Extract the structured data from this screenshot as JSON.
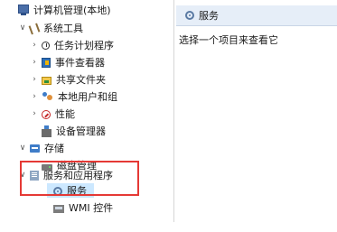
{
  "tree": {
    "root": "计算机管理(本地)",
    "system_tools": {
      "label": "系统工具",
      "items": [
        "任务计划程序",
        "事件查看器",
        "共享文件夹",
        "本地用户和组",
        "性能",
        "设备管理器"
      ]
    },
    "storage": {
      "label": "存储",
      "items": [
        "磁盘管理"
      ]
    },
    "services_apps": {
      "label": "服务和应用程序",
      "items": [
        "服务",
        "WMI 控件"
      ]
    }
  },
  "right_panel": {
    "header": "服务",
    "body_text": "选择一个项目来查看它"
  },
  "colors": {
    "selection_bg": "#cce8ff",
    "highlight_box": "#e53935",
    "header_bg": "#e6eef8"
  }
}
